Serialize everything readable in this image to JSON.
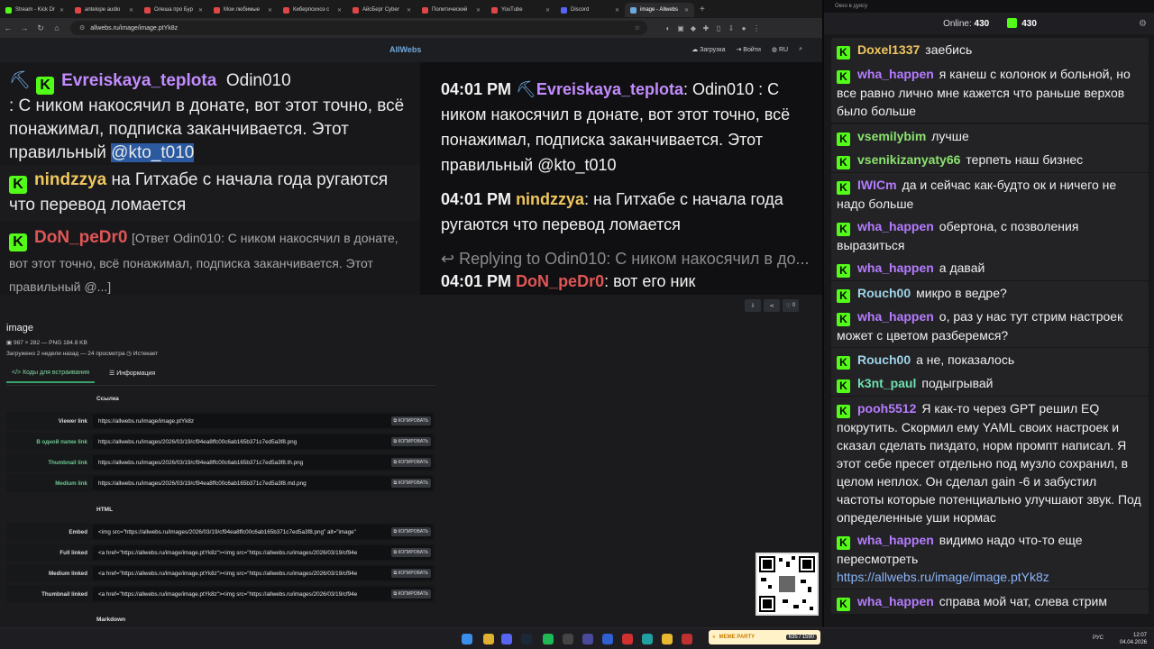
{
  "browser": {
    "tabs": [
      {
        "title": "Stream - Kick Dr",
        "color": "#53fc18"
      },
      {
        "title": "antelope audio",
        "color": "#e04646"
      },
      {
        "title": "Олеша про Бур",
        "color": "#e04646"
      },
      {
        "title": "Мои любимые",
        "color": "#e04646"
      },
      {
        "title": "Киберпсихоз с",
        "color": "#e04646"
      },
      {
        "title": "АйсБерг Cyber",
        "color": "#e04646"
      },
      {
        "title": "Политический",
        "color": "#e04646"
      },
      {
        "title": "YouTube",
        "color": "#e04646"
      },
      {
        "title": "Discord",
        "color": "#5865f2"
      },
      {
        "title": "image - Allwebs",
        "color": "#6fa8dc"
      }
    ],
    "url": "allwebs.ru/image/image.ptYk8z"
  },
  "site": {
    "logo": "AllWebs",
    "upload": "Загрузка",
    "login": "Войти",
    "lang": "RU"
  },
  "screenshot": {
    "left": [
      {
        "user": "Evreiskaya_teplota",
        "user2": "Odin010",
        "text": ": С ником накосячил в донате, вот этот точно, всё понажимал, подписка заканчивается. Этот правильный ",
        "mention": "@kto_t010"
      },
      {
        "user": "nindzzya",
        "text": "на Гитхабе с начала года ругаются что перевод ломается"
      },
      {
        "user": "DoN_peDr0",
        "text": "[Ответ Odin010: С ником накосячил в донате, вот этот точно, всё понажимал, подписка заканчивается. Этот правильный @...]"
      }
    ],
    "right": [
      {
        "time": "04:01 PM",
        "user": "Evreiskaya_teplota",
        "text": ": Odin010 : С ником накосячил в донате, вот этот точно, всё понажимал, подписка заканчивается. Этот правильный @kto_t010"
      },
      {
        "time": "04:01 PM",
        "user": "nindzzya",
        "text": ": на Гитхабе с начала года ругаются что перевод ломается"
      },
      {
        "reply": "Replying to Odin010: С ником накосячил в до..."
      },
      {
        "time": "04:01 PM",
        "user": "DoN_peDr0",
        "text": ": вот его ник"
      }
    ]
  },
  "actions": {
    "like_count": "0"
  },
  "image_meta": {
    "title": "image",
    "dims": "987 × 282 — PNG 184.8 KB",
    "uploaded": "Загружено 2 недели назад — 24 просмотра",
    "expires": "Истекает"
  },
  "subtabs": {
    "embed": "Коды для встраивания",
    "info": "Информация"
  },
  "sections": {
    "link": "Ссылка",
    "html": "HTML",
    "markdown": "Markdown"
  },
  "copy_label": "КОПИРОВАТЬ",
  "link_rows": [
    {
      "label": "Viewer link",
      "value": "https://allwebs.ru/image/image.ptYk8z"
    },
    {
      "label": "В одной папке link",
      "value": "https://allwebs.ru/images/2026/03/19/cf94ea8ffc00c6ab165b371c7ed5a3f8.png"
    },
    {
      "label": "Thumbnail link",
      "value": "https://allwebs.ru/images/2026/03/19/cf94ea8ffc00c6ab165b371c7ed5a3f8.th.png"
    },
    {
      "label": "Medium link",
      "value": "https://allwebs.ru/images/2026/03/19/cf94ea8ffc00c6ab165b371c7ed5a3f8.md.png"
    }
  ],
  "html_rows": [
    {
      "label": "Embed",
      "value": "<img src=\"https://allwebs.ru/images/2026/03/19/cf94ea8ffc00c6ab165b371c7ed5a3f8.png\" alt=\"image\""
    },
    {
      "label": "Full linked",
      "value": "<a href=\"https://allwebs.ru/image/image.ptYk8z\"><img src=\"https://allwebs.ru/images/2026/03/19/cf94e"
    },
    {
      "label": "Medium linked",
      "value": "<a href=\"https://allwebs.ru/image/image.ptYk8z\"><img src=\"https://allwebs.ru/images/2026/03/19/cf94e"
    },
    {
      "label": "Thumbnail linked",
      "value": "<a href=\"https://allwebs.ru/image/image.ptYk8z\"><img src=\"https://allwebs.ru/images/2026/03/19/cf94e"
    }
  ],
  "chat": {
    "window_title": "Окно в дуясу",
    "online_label": "Online:",
    "online": "430",
    "kick_count": "430",
    "messages": [
      {
        "user": "Doxel1337",
        "color": "#f0c75e",
        "text": "заебись"
      },
      {
        "user": "wha_happen",
        "color": "#b57cff",
        "text": "я канеш с колонок и больной, но все равно лично мне кажется что раньше верхов было больше"
      },
      {
        "user": "vsemilybim",
        "color": "#8be36f",
        "text": "лучше"
      },
      {
        "user": "vsenikizanyaty66",
        "color": "#8be36f",
        "text": "терпеть наш бизнес"
      },
      {
        "user": "IWICm",
        "color": "#b57cff",
        "text": "да и сейчас как-будто ок и ничего не надо больше"
      },
      {
        "user": "wha_happen",
        "color": "#b57cff",
        "text": "обертона, с позволения выразиться"
      },
      {
        "user": "wha_happen",
        "color": "#b57cff",
        "text": "а давай"
      },
      {
        "user": "Rouch00",
        "color": "#9fd3e8",
        "text": "микро в ведре?"
      },
      {
        "user": "wha_happen",
        "color": "#b57cff",
        "text": "о, раз у нас тут стрим настроек может с цветом разберемся?"
      },
      {
        "user": "Rouch00",
        "color": "#9fd3e8",
        "text": "а не, показалось"
      },
      {
        "user": "k3nt_paul",
        "color": "#6fe0b0",
        "text": "подыгрывай"
      },
      {
        "user": "pooh5512",
        "color": "#b57cff",
        "text": "Я как-то через GPT решил EQ покрутить. Скормил ему YAML своих настроек и сказал сделать пиздато, норм промпт написал. Я этот себе пресет отдельно под музло сохранил, в целом неплох. Он сделал gain -6 и забустил частоты которые потенциально улучшают звук. Под определенные уши нормас"
      },
      {
        "user": "wha_happen",
        "color": "#b57cff",
        "text": "видимо надо что-то еще пересмотреть",
        "link": "https://allwebs.ru/image/image.ptYk8z"
      },
      {
        "user": "wha_happen",
        "color": "#b57cff",
        "text": "справа мой чат, слева стрим"
      }
    ]
  },
  "taskbar": {
    "lang": "РУС",
    "time": "12:07",
    "date": "04.04.2026",
    "meme": "MEME PARTY",
    "meme_count": "635 / 1590"
  }
}
